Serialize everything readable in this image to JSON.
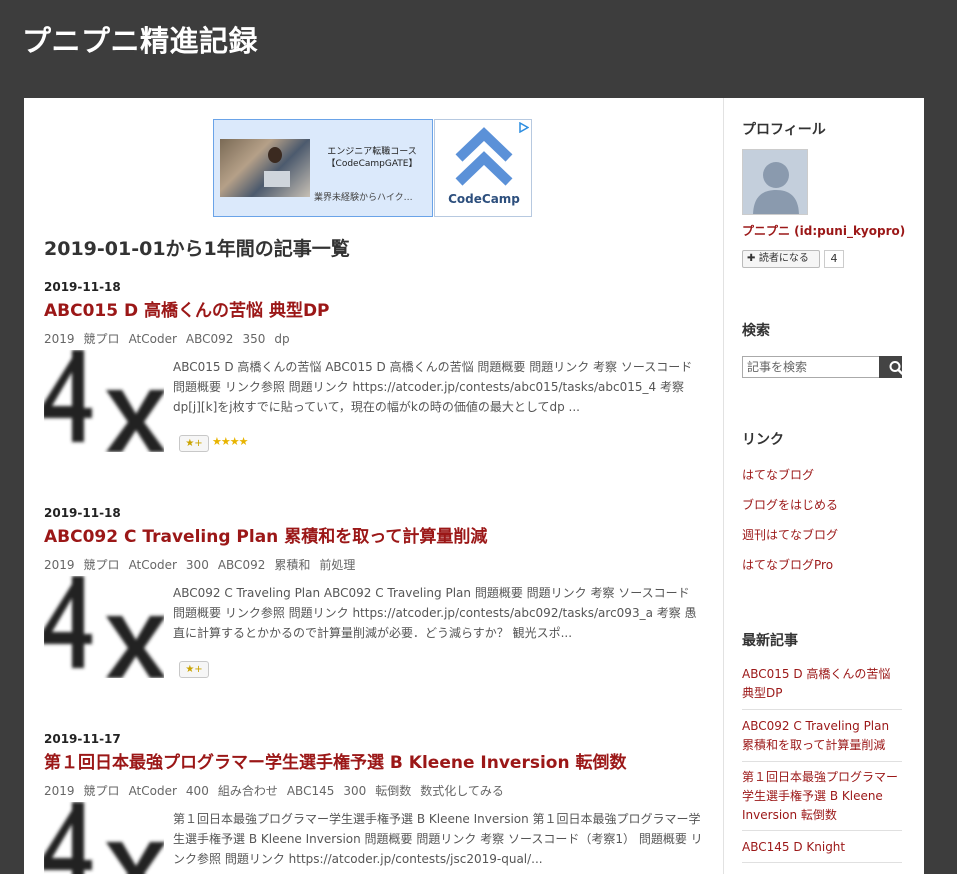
{
  "header": {
    "title": "プニプニ精進記録"
  },
  "ad": {
    "line1": "エンジニア転職コース",
    "line2": "【CodeCampGATE】",
    "line3": "業界未経験からハイク…",
    "logo_text": "CodeCamp"
  },
  "archive": {
    "heading": "2019-01-01から1年間の記事一覧"
  },
  "entries": [
    {
      "date": "2019-11-18",
      "title": "ABC015 D 高橋くんの苦悩 典型DP",
      "tags": [
        "2019",
        "競プロ",
        "AtCoder",
        "ABC092",
        "350",
        "dp"
      ],
      "summary": "ABC015 D 高橋くんの苦悩 ABC015 D 高橋くんの苦悩 問題概要 問題リンク 考察 ソースコード 問題概要 リンク参照 問題リンク https://atcoder.jp/contests/abc015/tasks/abc015_4 考察 dp[j][k]をj枚すでに貼っていて，現在の幅がkの時の価値の最大としてdp ...",
      "star_label": "★+",
      "stars": "★★★★"
    },
    {
      "date": "2019-11-18",
      "title": "ABC092 C Traveling Plan 累積和を取って計算量削減",
      "tags": [
        "2019",
        "競プロ",
        "AtCoder",
        "300",
        "ABC092",
        "累積和",
        "前処理"
      ],
      "summary": "ABC092 C Traveling Plan ABC092 C Traveling Plan 問題概要 問題リンク 考察 ソースコード 問題概要 リンク参照 問題リンク https://atcoder.jp/contests/abc092/tasks/arc093_a 考察 愚直に計算するとかかるので計算量削減が必要．どう減らすか？ 観光スポ...",
      "star_label": "★+",
      "stars": ""
    },
    {
      "date": "2019-11-17",
      "title": "第１回日本最強プログラマー学生選手権予選 B Kleene Inversion 転倒数",
      "tags": [
        "2019",
        "競プロ",
        "AtCoder",
        "400",
        "組み合わせ",
        "ABC145",
        "300",
        "転倒数",
        "数式化してみる"
      ],
      "summary": "第１回日本最強プログラマー学生選手権予選 B Kleene Inversion 第１回日本最強プログラマー学生選手権予選 B Kleene Inversion 問題概要 問題リンク 考察 ソースコード（考察1） 問題概要 リンク参照 問題リンク https://atcoder.jp/contests/jsc2019-qual/...",
      "star_label": "",
      "stars": ""
    }
  ],
  "sidebar": {
    "profile": {
      "heading": "プロフィール",
      "name": "プニプニ (id:puni_kyopro)",
      "subscribe_label": "読者になる",
      "subscribe_count": "4"
    },
    "search": {
      "heading": "検索",
      "placeholder": "記事を検索"
    },
    "links": {
      "heading": "リンク",
      "items": [
        "はてなブログ",
        "ブログをはじめる",
        "週刊はてなブログ",
        "はてなブログPro"
      ]
    },
    "recent": {
      "heading": "最新記事",
      "items": [
        "ABC015 D 高橋くんの苦悩 典型DP",
        "ABC092 C Traveling Plan 累積和を取って計算量削減",
        "第１回日本最強プログラマー学生選手権予選 B Kleene Inversion 転倒数",
        "ABC145 D Knight"
      ]
    }
  }
}
